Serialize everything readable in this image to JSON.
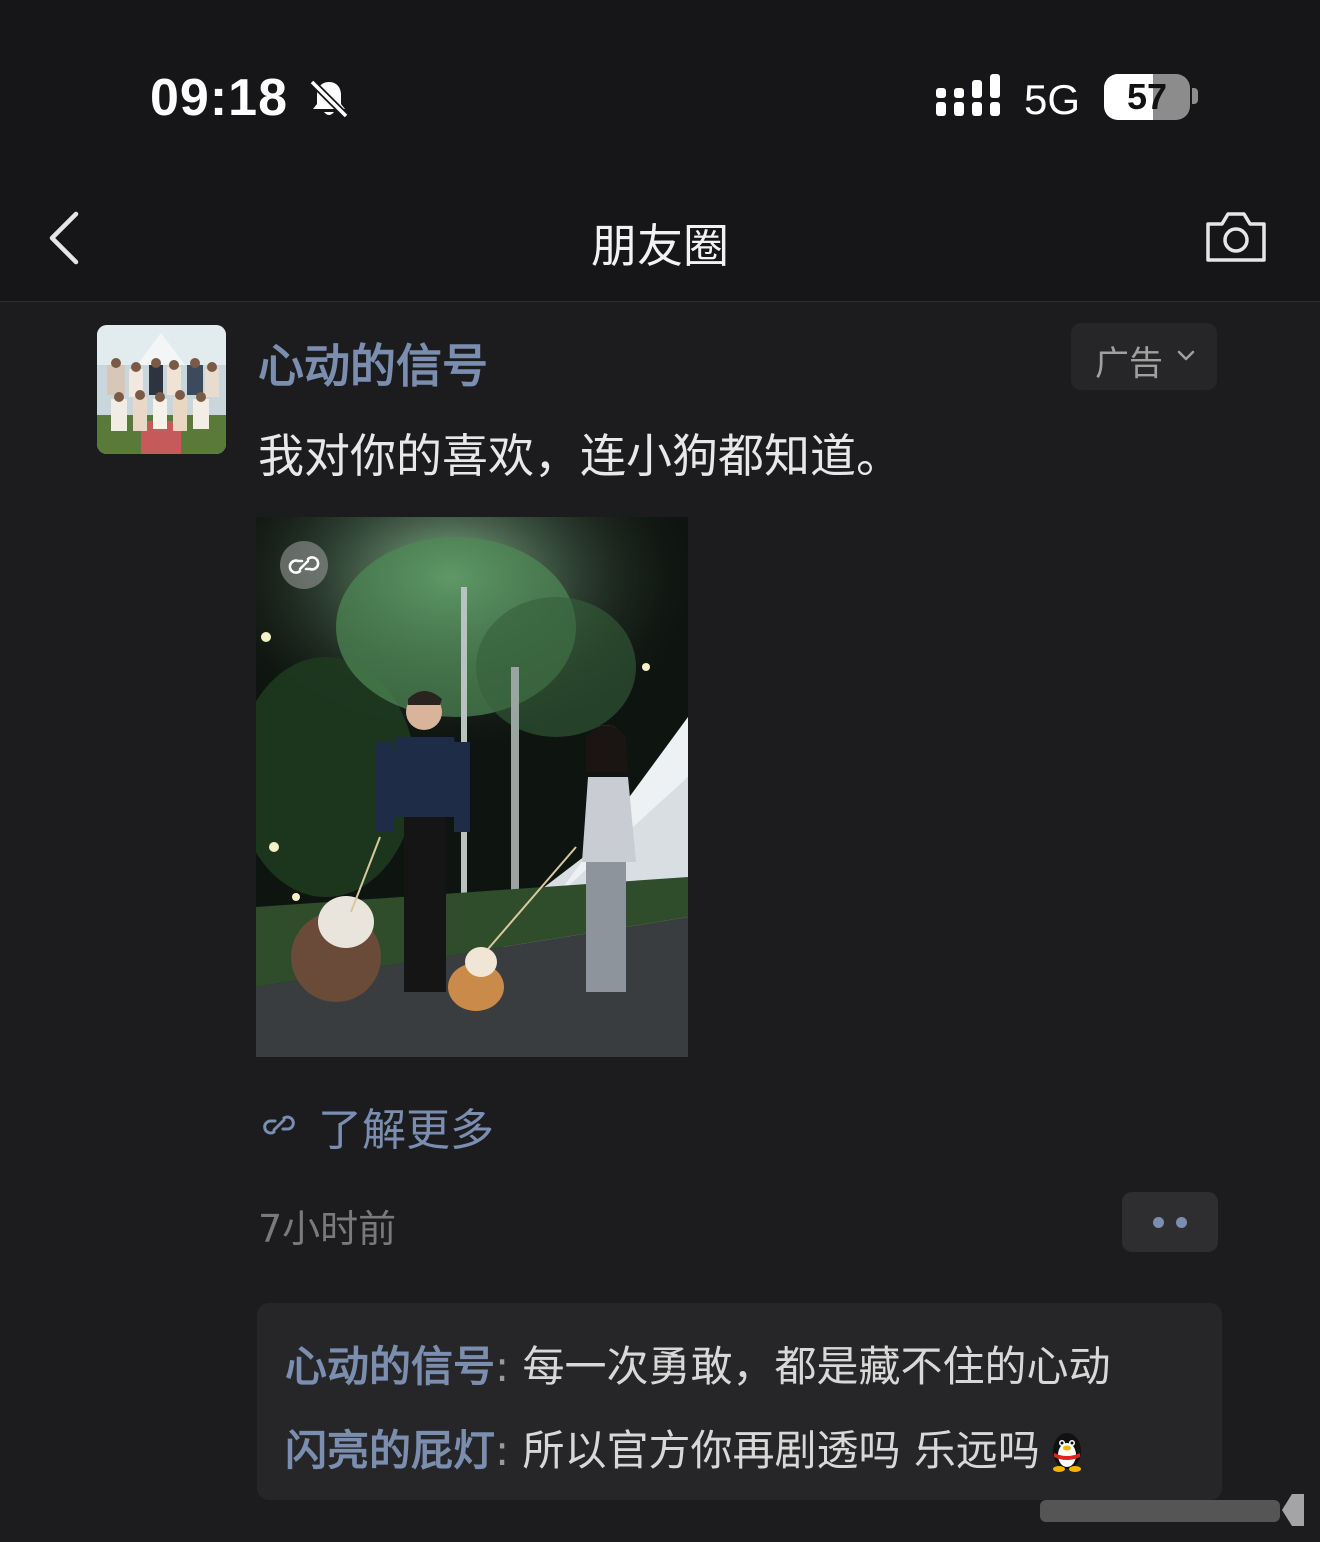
{
  "status_bar": {
    "time": "09:18",
    "network": "5G",
    "battery": "57",
    "battery_level": 0.57
  },
  "navbar": {
    "title": "朋友圈"
  },
  "post": {
    "author": "心动的信号",
    "ad_label": "广告",
    "text": "我对你的喜欢，连小狗都知道。",
    "learn_more": "了解更多",
    "time_ago": "7小时前"
  },
  "comments": [
    {
      "name": "心动的信号",
      "colon": ":",
      "text": " 每一次勇敢，都是藏不住的心动"
    },
    {
      "name": "闪亮的屁灯",
      "colon": ":",
      "text": " 所以官方你再剧透吗 乐远吗"
    }
  ],
  "colors": {
    "background": "#1c1c1e",
    "name_link": "#7b8eb0",
    "bubble": "#262628"
  },
  "icons": [
    "bell-off-icon",
    "signal-icon",
    "battery-icon",
    "back-chevron-icon",
    "camera-icon",
    "chevron-down-icon",
    "mini-program-link-icon",
    "more-dots-icon",
    "qq-penguin-emoji"
  ]
}
